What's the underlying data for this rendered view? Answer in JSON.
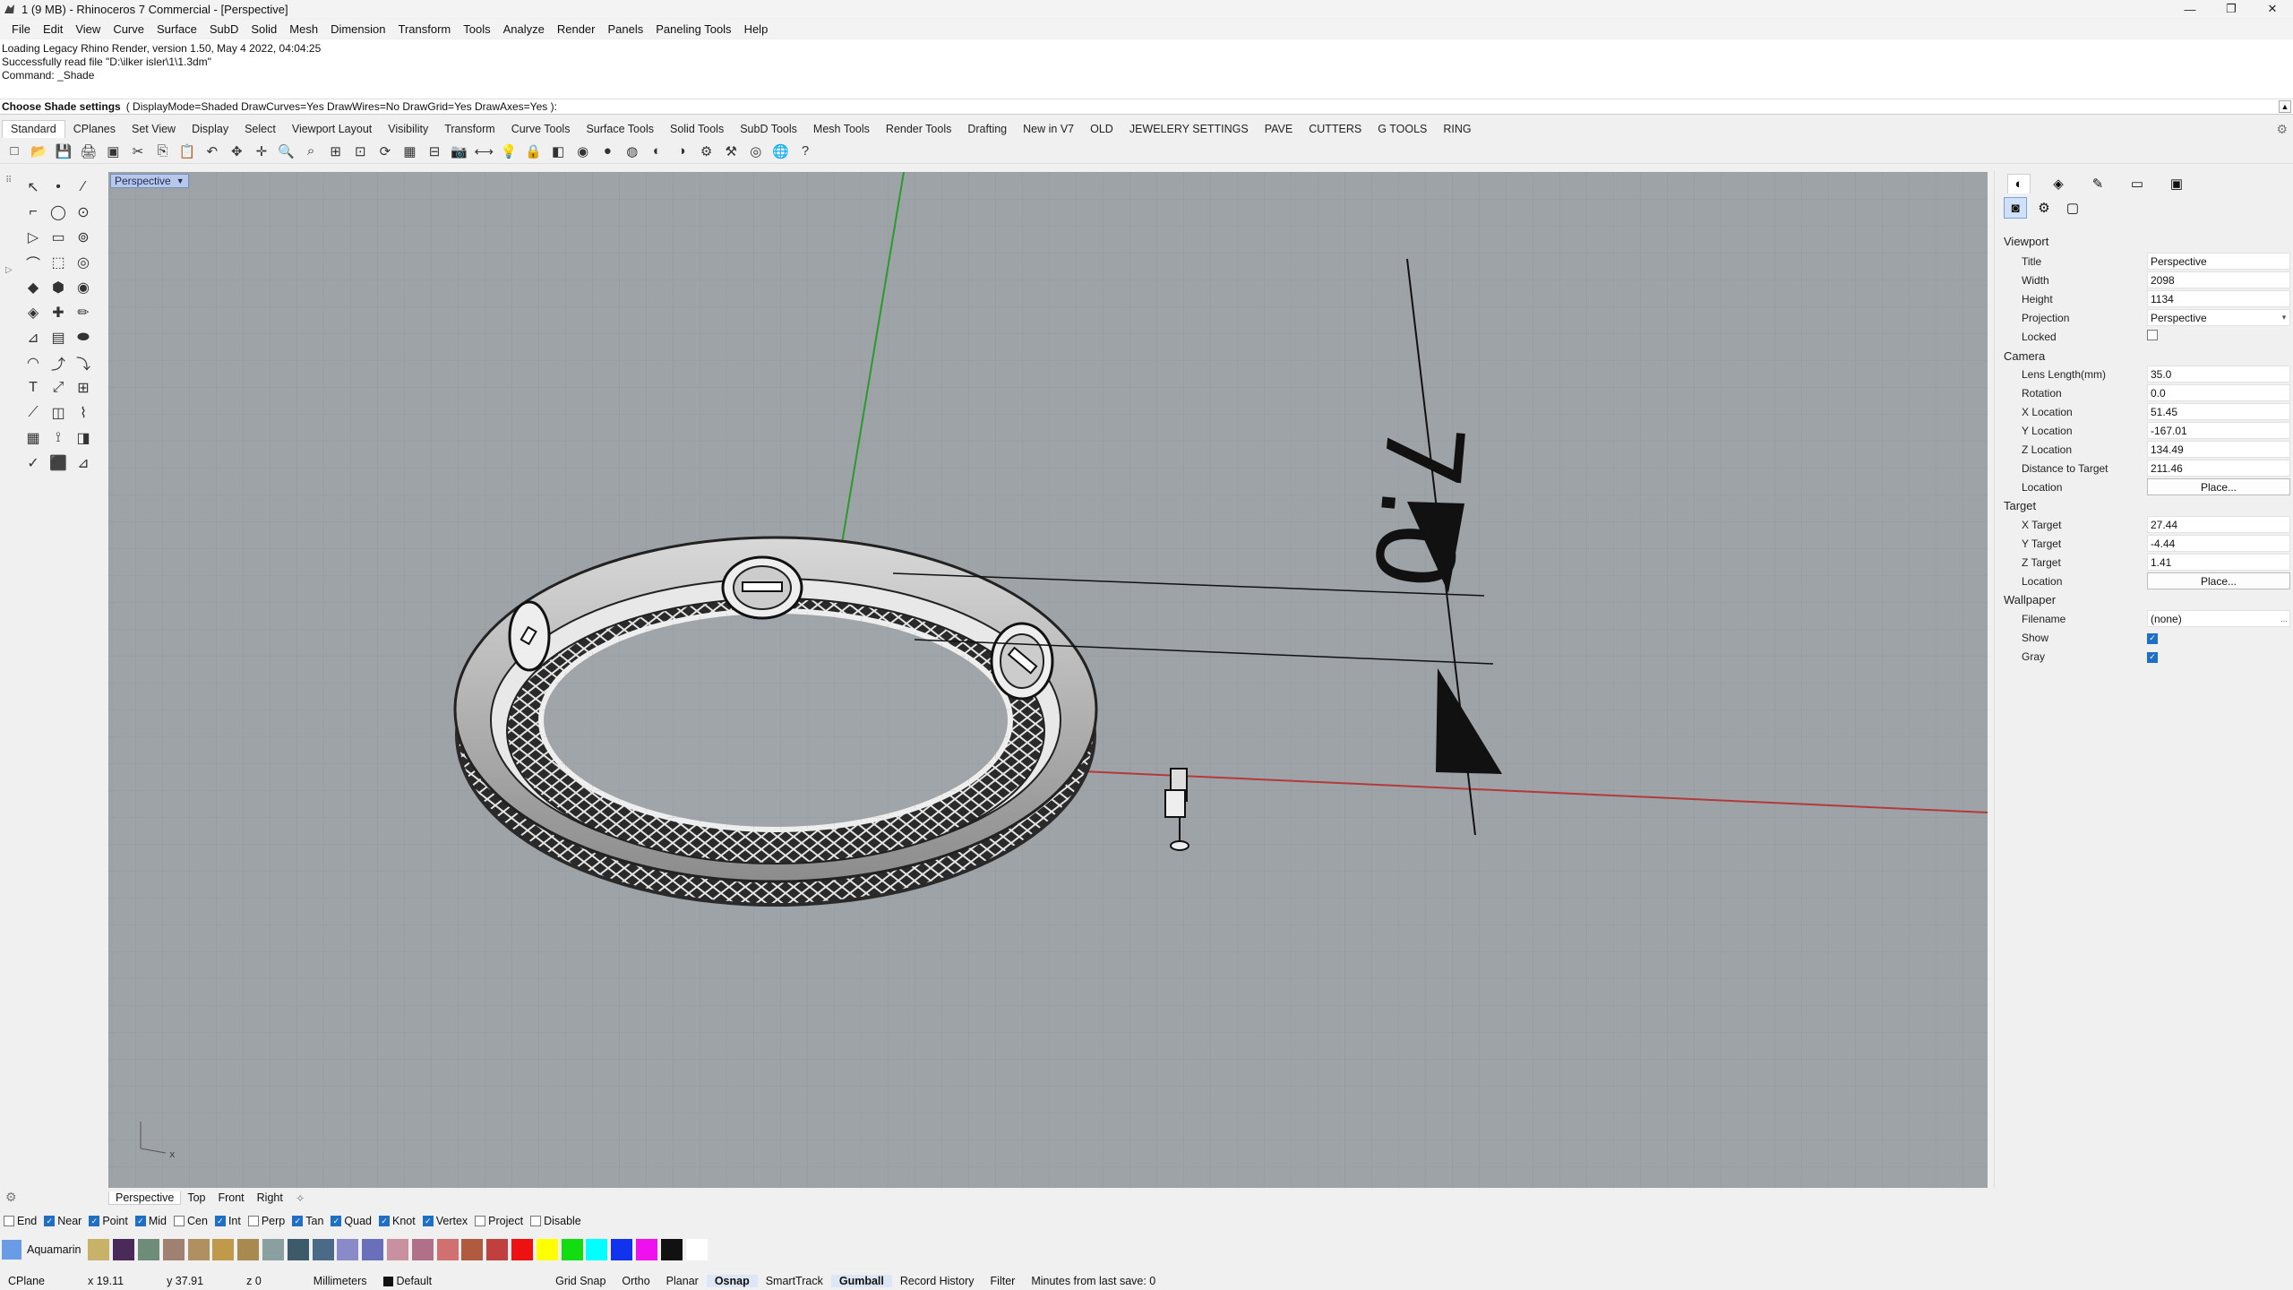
{
  "window": {
    "title": "1 (9 MB) - Rhinoceros 7 Commercial - [Perspective]",
    "controls": [
      "—",
      "❐",
      "✕"
    ]
  },
  "menu": [
    "File",
    "Edit",
    "View",
    "Curve",
    "Surface",
    "SubD",
    "Solid",
    "Mesh",
    "Dimension",
    "Transform",
    "Tools",
    "Analyze",
    "Render",
    "Panels",
    "Paneling Tools",
    "Help"
  ],
  "command_history": [
    "Loading Legacy Rhino Render, version 1.50, May  4 2022, 04:04:25",
    "Successfully read file \"D:\\ilker isler\\1\\1.3dm\"",
    "Command: _Shade"
  ],
  "command_prompt": {
    "prompt": "Choose Shade settings",
    "options": "( DisplayMode=Shaded  DrawCurves=Yes  DrawWires=No  DrawGrid=Yes  DrawAxes=Yes ):"
  },
  "toolbar_tabs": [
    "Standard",
    "CPlanes",
    "Set View",
    "Display",
    "Select",
    "Viewport Layout",
    "Visibility",
    "Transform",
    "Curve Tools",
    "Surface Tools",
    "Solid Tools",
    "SubD Tools",
    "Mesh Tools",
    "Render Tools",
    "Drafting",
    "New in V7",
    "OLD",
    "JEWELERY SETTINGS",
    "PAVE",
    "CUTTERS",
    "G TOOLS",
    "RING"
  ],
  "toolbar_icons": [
    "new-file-icon",
    "open-file-icon",
    "save-icon",
    "print-icon",
    "import-icon",
    "cut-icon",
    "copy-icon",
    "paste-icon",
    "undo-icon",
    "pan-icon",
    "move-icon",
    "zoom-dynamic-icon",
    "zoom-window-icon",
    "zoom-extents-icon",
    "zoom-selected-icon",
    "rotate-view-icon",
    "grid-icon",
    "cplane-icon",
    "camera-icon",
    "dimension-icon",
    "light-icon",
    "lock-icon",
    "layer-icon",
    "color-wheel-icon",
    "render-sphere-icon",
    "material-sphere-icon",
    "globe-icon",
    "env-icon",
    "tools-icon",
    "gear-options-icon",
    "ring-wizard-icon",
    "sphere-green-icon",
    "help-icon"
  ],
  "toolbar_glyphs": [
    "□",
    "📂",
    "💾",
    "🖨",
    "▣",
    "✂",
    "⎘",
    "📋",
    "↶",
    "✥",
    "✛",
    "🔍",
    "⌕",
    "⊞",
    "⊡",
    "⟳",
    "▦",
    "⊟",
    "📷",
    "⟷",
    "💡",
    "🔒",
    "◧",
    "◉",
    "●",
    "◍",
    "◐",
    "◑",
    "⚙",
    "⚒",
    "◎",
    "🌐",
    "?"
  ],
  "left_tool_glyphs": [
    "↖",
    "•",
    "∕",
    "⌐",
    "◯",
    "⊙",
    "▷",
    "▭",
    "⊚",
    "⌒",
    "⬚",
    "◎",
    "◆",
    "⬢",
    "◉",
    "◈",
    "✚",
    "✏",
    "⊿",
    "▤",
    "⬬",
    "◠",
    "⤴",
    "⤵",
    "T",
    "⤢",
    "⊞",
    "⟋",
    "◫",
    "⌇",
    "▦",
    "⟟",
    "◨",
    "✓",
    "⬛",
    "⊿"
  ],
  "viewport": {
    "label": "Perspective",
    "dimension_text": "7.0",
    "axis_icon_text": "x"
  },
  "viewport_tabs": [
    "Perspective",
    "Top",
    "Front",
    "Right"
  ],
  "osnaps": [
    {
      "label": "End",
      "checked": false
    },
    {
      "label": "Near",
      "checked": true
    },
    {
      "label": "Point",
      "checked": true
    },
    {
      "label": "Mid",
      "checked": true
    },
    {
      "label": "Cen",
      "checked": false
    },
    {
      "label": "Int",
      "checked": true
    },
    {
      "label": "Perp",
      "checked": false
    },
    {
      "label": "Tan",
      "checked": true
    },
    {
      "label": "Quad",
      "checked": true
    },
    {
      "label": "Knot",
      "checked": true
    },
    {
      "label": "Vertex",
      "checked": true
    },
    {
      "label": "Project",
      "checked": false
    },
    {
      "label": "Disable",
      "checked": false
    }
  ],
  "current_layer": "Aquamarin",
  "layer_colors": [
    "#c8b26a",
    "#4a2a58",
    "#6e8c78",
    "#a08070",
    "#b09060",
    "#c09a4a",
    "#a88a50",
    "#8aa0a0",
    "#3c5a6a",
    "#4a6a88",
    "#8a8ac8",
    "#6a70b8",
    "#c890a0",
    "#b07088",
    "#d07070",
    "#b05a40",
    "#c04040",
    "#ee1111",
    "#ffff00",
    "#11dd11",
    "#00ffff",
    "#1133ee",
    "#ee11ee",
    "#111111",
    "#ffffff"
  ],
  "status": {
    "cplane": "CPlane",
    "x": "x 19.11",
    "y": "y 37.91",
    "z": "z 0",
    "units": "Millimeters",
    "layer": "Default",
    "buttons": [
      "Grid Snap",
      "Ortho",
      "Planar",
      "Osnap",
      "SmartTrack",
      "Gumball",
      "Record History",
      "Filter",
      "Minutes from last save: 0"
    ]
  },
  "panel": {
    "tab_icons": [
      "color-circle-icon",
      "material-icon",
      "brush-icon",
      "folder-icon",
      "image-icon"
    ],
    "viewport_section": "Viewport",
    "viewport": [
      {
        "k": "Title",
        "v": "Perspective"
      },
      {
        "k": "Width",
        "v": "2098"
      },
      {
        "k": "Height",
        "v": "1134"
      },
      {
        "k": "Projection",
        "v": "Perspective"
      },
      {
        "k": "Locked",
        "v": ""
      }
    ],
    "camera_section": "Camera",
    "camera": [
      {
        "k": "Lens Length(mm)",
        "v": "35.0"
      },
      {
        "k": "Rotation",
        "v": "0.0"
      },
      {
        "k": "X Location",
        "v": "51.45"
      },
      {
        "k": "Y Location",
        "v": "-167.01"
      },
      {
        "k": "Z Location",
        "v": "134.49"
      },
      {
        "k": "Distance to Target",
        "v": "211.46"
      },
      {
        "k": "Location",
        "v": "Place..."
      }
    ],
    "target_section": "Target",
    "target": [
      {
        "k": "X Target",
        "v": "27.44"
      },
      {
        "k": "Y Target",
        "v": "-4.44"
      },
      {
        "k": "Z Target",
        "v": "1.41"
      },
      {
        "k": "Location",
        "v": "Place..."
      }
    ],
    "wallpaper_section": "Wallpaper",
    "wallpaper": [
      {
        "k": "Filename",
        "v": "(none)"
      },
      {
        "k": "Show",
        "v": ""
      },
      {
        "k": "Gray",
        "v": ""
      }
    ],
    "ellipsis": "..."
  }
}
